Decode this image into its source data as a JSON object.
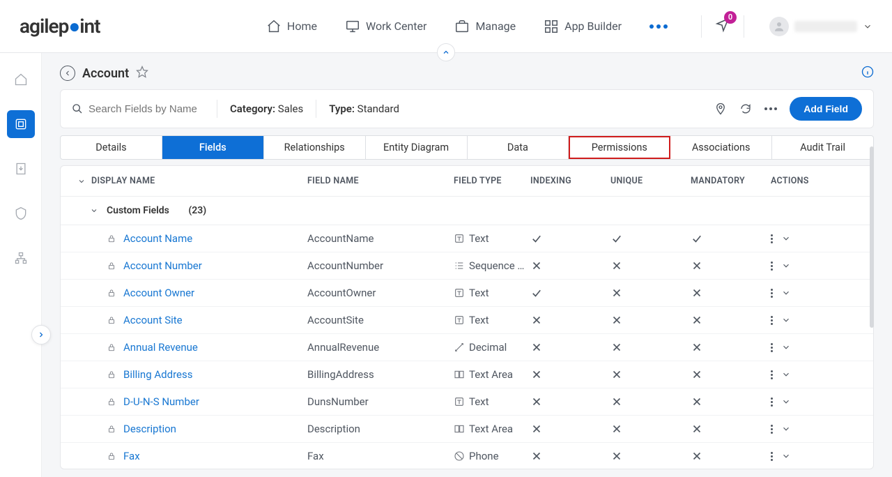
{
  "header": {
    "logo_left": "agilep",
    "logo_right": "int",
    "nav": [
      "Home",
      "Work Center",
      "Manage",
      "App Builder"
    ],
    "badge": "0"
  },
  "page": {
    "title": "Account",
    "search_placeholder": "Search Fields by Name",
    "category_label": "Category:",
    "category_value": "Sales",
    "type_label": "Type:",
    "type_value": "Standard",
    "add_button": "Add Field"
  },
  "tabs": [
    "Details",
    "Fields",
    "Relationships",
    "Entity Diagram",
    "Data",
    "Permissions",
    "Associations",
    "Audit Trail"
  ],
  "active_tab": 1,
  "highlighted_tab": 5,
  "columns": [
    "DISPLAY NAME",
    "FIELD NAME",
    "FIELD TYPE",
    "INDEXING",
    "UNIQUE",
    "MANDATORY",
    "ACTIONS"
  ],
  "group": {
    "label": "Custom Fields",
    "count": "(23)"
  },
  "rows": [
    {
      "display": "Account Name",
      "field": "AccountName",
      "type": "Text",
      "type_icon": "text",
      "idx": true,
      "uni": true,
      "man": true
    },
    {
      "display": "Account Number",
      "field": "AccountNumber",
      "type": "Sequence N...",
      "type_icon": "sequence",
      "idx": false,
      "uni": false,
      "man": false
    },
    {
      "display": "Account Owner",
      "field": "AccountOwner",
      "type": "Text",
      "type_icon": "text",
      "idx": true,
      "uni": false,
      "man": false
    },
    {
      "display": "Account Site",
      "field": "AccountSite",
      "type": "Text",
      "type_icon": "text",
      "idx": false,
      "uni": false,
      "man": false
    },
    {
      "display": "Annual Revenue",
      "field": "AnnualRevenue",
      "type": "Decimal",
      "type_icon": "decimal",
      "idx": false,
      "uni": false,
      "man": false
    },
    {
      "display": "Billing Address",
      "field": "BillingAddress",
      "type": "Text Area",
      "type_icon": "textarea",
      "idx": false,
      "uni": false,
      "man": false
    },
    {
      "display": "D-U-N-S Number",
      "field": "DunsNumber",
      "type": "Text",
      "type_icon": "text",
      "idx": false,
      "uni": false,
      "man": false
    },
    {
      "display": "Description",
      "field": "Description",
      "type": "Text Area",
      "type_icon": "textarea",
      "idx": false,
      "uni": false,
      "man": false
    },
    {
      "display": "Fax",
      "field": "Fax",
      "type": "Phone",
      "type_icon": "phone",
      "idx": false,
      "uni": false,
      "man": false
    }
  ]
}
